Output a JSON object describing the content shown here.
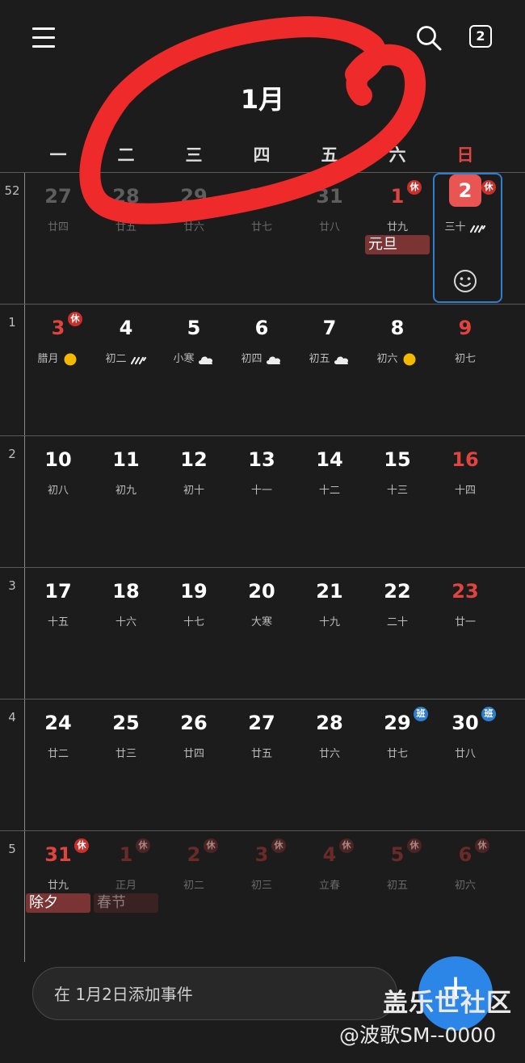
{
  "header": {
    "month_title": "1月",
    "today_badge": "2"
  },
  "weekdays": [
    "一",
    "二",
    "三",
    "四",
    "五",
    "六",
    "日"
  ],
  "weeks": [
    {
      "number": "52",
      "days": [
        {
          "day": "27",
          "lunar": "廿四",
          "style": "dimwhite"
        },
        {
          "day": "28",
          "lunar": "廿五",
          "style": "dimwhite"
        },
        {
          "day": "29",
          "lunar": "廿六",
          "style": "dimwhite"
        },
        {
          "day": "30",
          "lunar": "廿七",
          "style": "dimwhite"
        },
        {
          "day": "31",
          "lunar": "廿八",
          "style": "dimwhite"
        },
        {
          "day": "1",
          "lunar": "廿九",
          "style": "red",
          "badge": "休",
          "badge_type": "rest",
          "event": "元旦"
        },
        {
          "day": "2",
          "lunar": "三十",
          "style": "selected",
          "badge": "休",
          "badge_type": "rest",
          "weather": "rain-icon"
        }
      ]
    },
    {
      "number": "1",
      "days": [
        {
          "day": "3",
          "lunar": "腊月",
          "style": "red",
          "badge": "休",
          "badge_type": "rest",
          "weather": "sun-icon"
        },
        {
          "day": "4",
          "lunar": "初二",
          "style": "white",
          "weather": "rain-icon"
        },
        {
          "day": "5",
          "lunar": "小寒",
          "style": "white",
          "weather": "cloud-icon"
        },
        {
          "day": "6",
          "lunar": "初四",
          "style": "white",
          "weather": "cloud-icon"
        },
        {
          "day": "7",
          "lunar": "初五",
          "style": "white",
          "weather": "cloud-icon"
        },
        {
          "day": "8",
          "lunar": "初六",
          "style": "white",
          "weather": "sun-icon"
        },
        {
          "day": "9",
          "lunar": "初七",
          "style": "red"
        }
      ]
    },
    {
      "number": "2",
      "days": [
        {
          "day": "10",
          "lunar": "初八",
          "style": "white"
        },
        {
          "day": "11",
          "lunar": "初九",
          "style": "white"
        },
        {
          "day": "12",
          "lunar": "初十",
          "style": "white"
        },
        {
          "day": "13",
          "lunar": "十一",
          "style": "white"
        },
        {
          "day": "14",
          "lunar": "十二",
          "style": "white"
        },
        {
          "day": "15",
          "lunar": "十三",
          "style": "white"
        },
        {
          "day": "16",
          "lunar": "十四",
          "style": "red"
        }
      ]
    },
    {
      "number": "3",
      "days": [
        {
          "day": "17",
          "lunar": "十五",
          "style": "white"
        },
        {
          "day": "18",
          "lunar": "十六",
          "style": "white"
        },
        {
          "day": "19",
          "lunar": "十七",
          "style": "white"
        },
        {
          "day": "20",
          "lunar": "大寒",
          "style": "white"
        },
        {
          "day": "21",
          "lunar": "十九",
          "style": "white"
        },
        {
          "day": "22",
          "lunar": "二十",
          "style": "white"
        },
        {
          "day": "23",
          "lunar": "廿一",
          "style": "red"
        }
      ]
    },
    {
      "number": "4",
      "days": [
        {
          "day": "24",
          "lunar": "廿二",
          "style": "white"
        },
        {
          "day": "25",
          "lunar": "廿三",
          "style": "white"
        },
        {
          "day": "26",
          "lunar": "廿四",
          "style": "white"
        },
        {
          "day": "27",
          "lunar": "廿五",
          "style": "white"
        },
        {
          "day": "28",
          "lunar": "廿六",
          "style": "white"
        },
        {
          "day": "29",
          "lunar": "廿七",
          "style": "white",
          "badge": "班",
          "badge_type": "work"
        },
        {
          "day": "30",
          "lunar": "廿八",
          "style": "white",
          "badge": "班",
          "badge_type": "work"
        }
      ]
    },
    {
      "number": "5",
      "days": [
        {
          "day": "31",
          "lunar": "廿九",
          "style": "red",
          "badge": "休",
          "badge_type": "rest",
          "event": "除夕"
        },
        {
          "day": "1",
          "lunar": "正月",
          "style": "dimred",
          "badge": "休",
          "badge_type": "dim",
          "event": "春节",
          "event_dim": true
        },
        {
          "day": "2",
          "lunar": "初二",
          "style": "dimred",
          "badge": "休",
          "badge_type": "dim"
        },
        {
          "day": "3",
          "lunar": "初三",
          "style": "dimred",
          "badge": "休",
          "badge_type": "dim"
        },
        {
          "day": "4",
          "lunar": "立春",
          "style": "dimred",
          "badge": "休",
          "badge_type": "dim"
        },
        {
          "day": "5",
          "lunar": "初五",
          "style": "dimred",
          "badge": "休",
          "badge_type": "dim"
        },
        {
          "day": "6",
          "lunar": "初六",
          "style": "dimred",
          "badge": "休",
          "badge_type": "dim"
        }
      ]
    }
  ],
  "add_event": {
    "placeholder": "在 1月2日添加事件"
  },
  "fab": {
    "icon": "plus-icon",
    "label": "+"
  },
  "watermark": {
    "line1": "盖乐世社区",
    "line2": "@波歌SM--0000"
  },
  "colors": {
    "background": "#1c1c1c",
    "red": "#e0443e",
    "accent_blue": "#2b86e8",
    "annotation_red": "#ee2a2a"
  }
}
